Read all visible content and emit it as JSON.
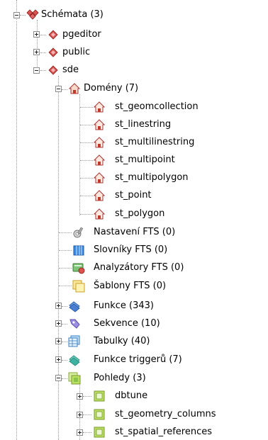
{
  "tree": {
    "schemas": {
      "label": "Schémata (3)"
    },
    "pgeditor": {
      "label": "pgeditor"
    },
    "public": {
      "label": "public"
    },
    "sde": {
      "label": "sde"
    },
    "domains": {
      "label": "Domény (7)",
      "items": [
        "st_geomcollection",
        "st_linestring",
        "st_multilinestring",
        "st_multipoint",
        "st_multipolygon",
        "st_point",
        "st_polygon"
      ]
    },
    "fts_config": {
      "label": "Nastavení FTS (0)"
    },
    "fts_dict": {
      "label": "Slovníky FTS (0)"
    },
    "fts_parser": {
      "label": "Analyzátory FTS (0)"
    },
    "fts_template": {
      "label": "Šablony FTS (0)"
    },
    "functions": {
      "label": "Funkce (343)"
    },
    "sequences": {
      "label": "Sekvence (10)"
    },
    "tables": {
      "label": "Tabulky (40)"
    },
    "trigger_functions": {
      "label": "Funkce triggerů (7)"
    },
    "views": {
      "label": "Pohledy (3)",
      "items": [
        "dbtune",
        "st_geometry_columns",
        "st_spatial_references"
      ]
    }
  },
  "colors": {
    "schema_icon": "#c0392b",
    "domain_icon": "#b03a2e",
    "view_icon": "#8bc34a",
    "function_icon": "#4a7fd4",
    "connector": "#9a9a9a"
  }
}
